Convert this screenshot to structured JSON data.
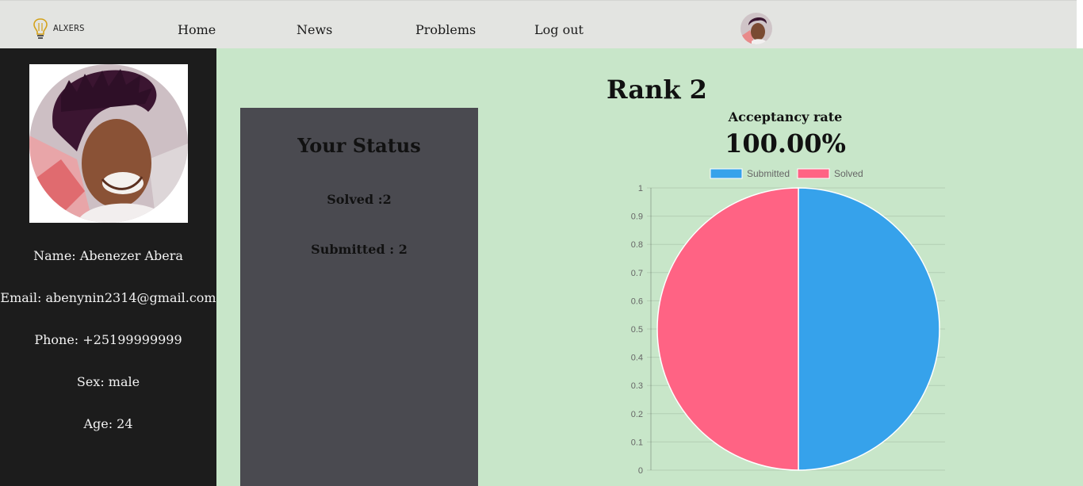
{
  "nav": {
    "logo_text": "ALXERS",
    "links": [
      "Home",
      "News",
      "Problems",
      "Log out"
    ]
  },
  "profile": {
    "name": "Name: Abenezer Abera",
    "email": "Email: abenynin2314@gmail.com",
    "phone": "Phone: +25199999999",
    "sex": "Sex: male",
    "age": "Age: 24"
  },
  "rank": {
    "title": "Rank 2"
  },
  "status": {
    "title": "Your Status",
    "solved": "Solved :2",
    "submitted": "Submitted : 2"
  },
  "chart_data": {
    "type": "pie",
    "title": "Acceptancy rate",
    "subtitle": "100.00%",
    "labels": [
      "Submitted",
      "Solved"
    ],
    "values": [
      2,
      2
    ],
    "colors": [
      "#36a2eb",
      "#ff6384"
    ],
    "legend": "top",
    "y_ticks": [
      "1",
      "0.9",
      "0.8",
      "0.7",
      "0.6",
      "0.5",
      "0.4",
      "0.3",
      "0.2",
      "0.1",
      "0"
    ],
    "ylim": [
      0,
      1
    ],
    "grid": true
  },
  "colors": {
    "navbar_bg": "#e3e4e1",
    "sidebar_bg": "#1c1c1c",
    "main_bg": "#c8e6c9",
    "status_panel_bg": "#4a4a50"
  },
  "icons": {
    "logo": "lightbulb-icon",
    "avatar": "user-avatar"
  }
}
